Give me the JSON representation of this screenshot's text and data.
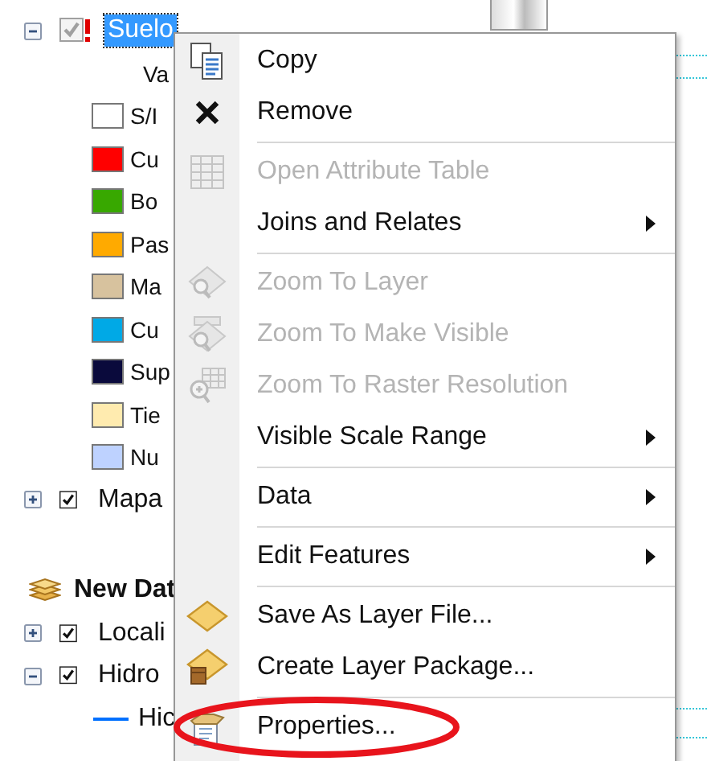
{
  "tree": [
    {
      "kind": "layer",
      "label": "Suelo",
      "checked": true,
      "expanded": true,
      "selected": true,
      "warning": true,
      "children": [
        {
          "kind": "heading",
          "label": "Va"
        },
        {
          "kind": "legend",
          "label": "S/I",
          "color": "#ffffff"
        },
        {
          "kind": "legend",
          "label": "Cu",
          "color": "#ff0000"
        },
        {
          "kind": "legend",
          "label": "Bo",
          "color": "#38a800"
        },
        {
          "kind": "legend",
          "label": "Pas",
          "color": "#ffaa00"
        },
        {
          "kind": "legend",
          "label": "Ma",
          "color": "#d7c29e"
        },
        {
          "kind": "legend",
          "label": "Cu",
          "color": "#00a9e6"
        },
        {
          "kind": "legend",
          "label": "Sup",
          "color": "#0a0a3c"
        },
        {
          "kind": "legend",
          "label": "Tie",
          "color": "#ffebaf"
        },
        {
          "kind": "legend",
          "label": "Nu",
          "color": "#bed2ff"
        }
      ]
    },
    {
      "kind": "layer",
      "label": "Mapa",
      "checked": true,
      "expanded": false,
      "selected": false,
      "warning": false
    },
    {
      "kind": "group",
      "label": "New Dat"
    },
    {
      "kind": "layer",
      "label": "Locali",
      "checked": true,
      "expanded": false,
      "selected": false,
      "warning": false
    },
    {
      "kind": "layer",
      "label": "Hidro",
      "checked": true,
      "expanded": true,
      "selected": false,
      "warning": false,
      "children": [
        {
          "kind": "line",
          "label": "Hic",
          "color": "#0070ff"
        }
      ]
    }
  ],
  "menu": [
    {
      "kind": "item",
      "label": "Copy",
      "disabled": false,
      "submenu": false
    },
    {
      "kind": "item",
      "label": "Remove",
      "disabled": false,
      "submenu": false
    },
    {
      "kind": "separator"
    },
    {
      "kind": "item",
      "label": "Open Attribute Table",
      "disabled": true,
      "submenu": false
    },
    {
      "kind": "item",
      "label": "Joins and Relates",
      "disabled": false,
      "submenu": true
    },
    {
      "kind": "separator"
    },
    {
      "kind": "item",
      "label": "Zoom To Layer",
      "disabled": true,
      "submenu": false
    },
    {
      "kind": "item",
      "label": "Zoom To Make Visible",
      "disabled": true,
      "submenu": false
    },
    {
      "kind": "item",
      "label": "Zoom To Raster Resolution",
      "disabled": true,
      "submenu": false
    },
    {
      "kind": "item",
      "label": "Visible Scale Range",
      "disabled": false,
      "submenu": true
    },
    {
      "kind": "separator"
    },
    {
      "kind": "item",
      "label": "Data",
      "disabled": false,
      "submenu": true
    },
    {
      "kind": "separator"
    },
    {
      "kind": "item",
      "label": "Edit Features",
      "disabled": false,
      "submenu": true
    },
    {
      "kind": "separator"
    },
    {
      "kind": "item",
      "label": "Save As Layer File...",
      "disabled": false,
      "submenu": false
    },
    {
      "kind": "item",
      "label": "Create Layer Package...",
      "disabled": false,
      "submenu": false
    },
    {
      "kind": "separator"
    },
    {
      "kind": "item",
      "label": "Properties...",
      "disabled": false,
      "submenu": false,
      "circled": true
    }
  ]
}
